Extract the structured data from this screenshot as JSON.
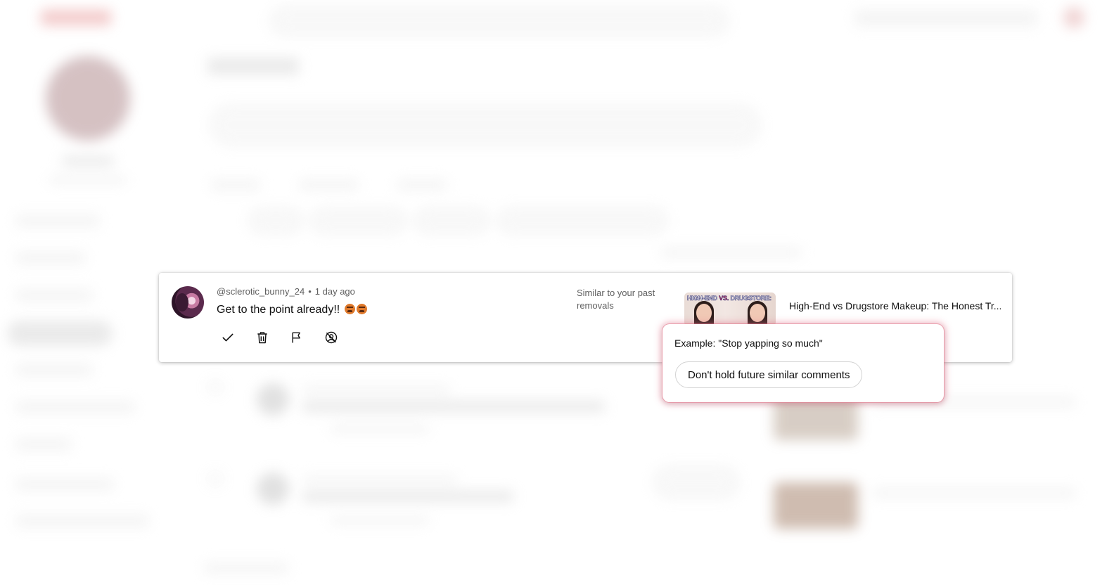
{
  "comment": {
    "author": "@sclerotic_bunny_24",
    "separator": "•",
    "time": "1 day ago",
    "text": "Get to the point already!!",
    "emojis": [
      "enraged-face",
      "enraged-face"
    ],
    "reason": "Similar to your past removals",
    "actions": [
      "approve",
      "delete",
      "report",
      "hide-user"
    ]
  },
  "video": {
    "thumbnail_text_top": "HIGH-END",
    "thumbnail_text_vs": "VS.",
    "thumbnail_text_rest": "DRUGSTORE:",
    "title": "High-End vs Drugstore Makeup: The Honest Tr..."
  },
  "popup": {
    "example": "Example: \"Stop yapping so much\"",
    "button_label": "Don't hold future similar comments"
  },
  "colors": {
    "popup_glow": "#eb7891",
    "secondary_text": "#606060"
  }
}
